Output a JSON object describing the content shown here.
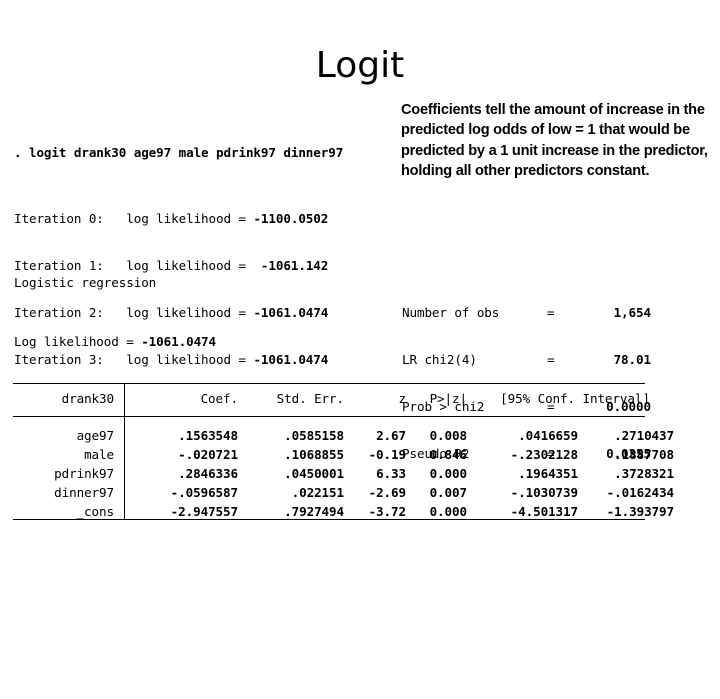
{
  "slide": {
    "title": "Logit"
  },
  "note": {
    "text": "Coefficients tell the amount of increase in the predicted log odds of low = 1 that would be predicted by a 1 unit increase in the predictor, holding all other predictors constant."
  },
  "stata": {
    "command": ". logit drank30 age97 male pdrink97 dinner97",
    "iterations": [
      {
        "label": "Iteration 0:   log likelihood = ",
        "value": "-1100.0502"
      },
      {
        "label": "Iteration 1:   log likelihood =  ",
        "value": "-1061.142"
      },
      {
        "label": "Iteration 2:   log likelihood = ",
        "value": "-1061.0474"
      },
      {
        "label": "Iteration 3:   log likelihood = ",
        "value": "-1061.0474"
      }
    ],
    "model_label": "Logistic regression",
    "loglik_label": "Log likelihood = ",
    "loglik_value": "-1061.0474",
    "fit_stats": [
      {
        "name": "Number of obs",
        "eq": "=",
        "value": "1,654"
      },
      {
        "name": "LR chi2(4)",
        "eq": "=",
        "value": "78.01"
      },
      {
        "name": "Prob > chi2",
        "eq": "=",
        "value": "0.0000"
      },
      {
        "name": "Pseudo R2",
        "eq": "=",
        "value": "0.0355"
      }
    ],
    "table": {
      "header": {
        "depvar": "drank30",
        "coef": "Coef.",
        "stderr": "Std. Err.",
        "z": "z",
        "p": "P>|z|",
        "ci": "[95% Conf. Interval]"
      },
      "rows": [
        {
          "name": "age97",
          "coef": ".1563548",
          "stderr": ".0585158",
          "z": "2.67",
          "p": "0.008",
          "ci_low": ".0416659",
          "ci_high": ".2710437"
        },
        {
          "name": "male",
          "coef": "-.020721",
          "stderr": ".1068855",
          "z": "-0.19",
          "p": "0.846",
          "ci_low": "-.2302128",
          "ci_high": ".1887708"
        },
        {
          "name": "pdrink97",
          "coef": ".2846336",
          "stderr": ".0450001",
          "z": "6.33",
          "p": "0.000",
          "ci_low": ".1964351",
          "ci_high": ".3728321"
        },
        {
          "name": "dinner97",
          "coef": "-.0596587",
          "stderr": ".022151",
          "z": "-2.69",
          "p": "0.007",
          "ci_low": "-.1030739",
          "ci_high": "-.0162434"
        },
        {
          "name": "_cons",
          "coef": "-2.947557",
          "stderr": ".7927494",
          "z": "-3.72",
          "p": "0.000",
          "ci_low": "-4.501317",
          "ci_high": "-1.393797"
        }
      ]
    }
  }
}
